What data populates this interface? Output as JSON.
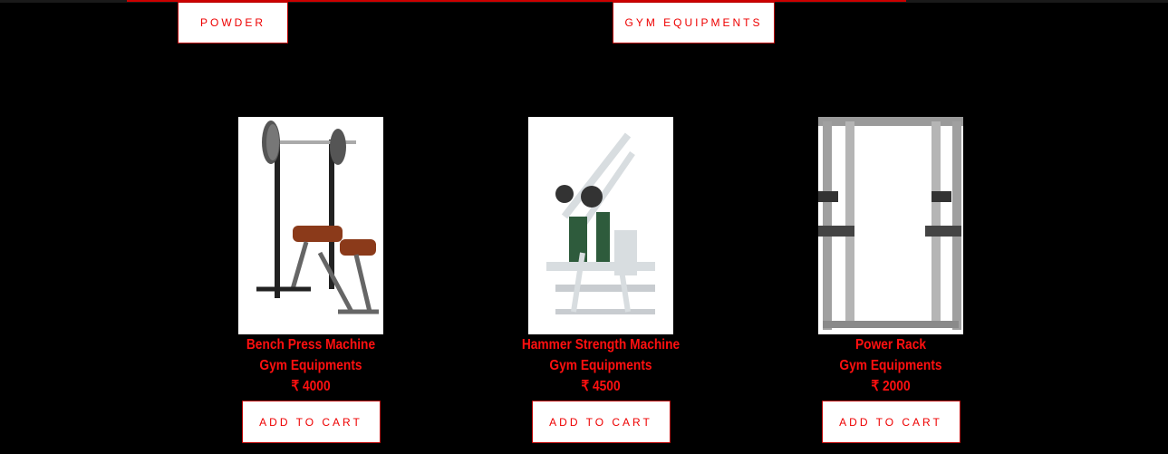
{
  "categories": [
    {
      "label": "POWDER"
    },
    {
      "label": "GYM EQUIPMENTS"
    }
  ],
  "products": [
    {
      "name": "Bench Press Machine",
      "category": "Gym Equipments",
      "price": "₹ 4000",
      "button": "ADD TO CART",
      "image": "bench-press-machine-image"
    },
    {
      "name": "Hammer Strength Machine",
      "category": "Gym Equipments",
      "price": "₹ 4500",
      "button": "ADD TO CART",
      "image": "hammer-strength-machine-image"
    },
    {
      "name": "Power Rack",
      "category": "Gym Equipments",
      "price": "₹ 2000",
      "button": "ADD TO CART",
      "image": "power-rack-image"
    }
  ],
  "colors": {
    "accent": "#ff1010",
    "background": "#000000",
    "button_bg": "#ffffff",
    "button_border": "#bb0000"
  }
}
